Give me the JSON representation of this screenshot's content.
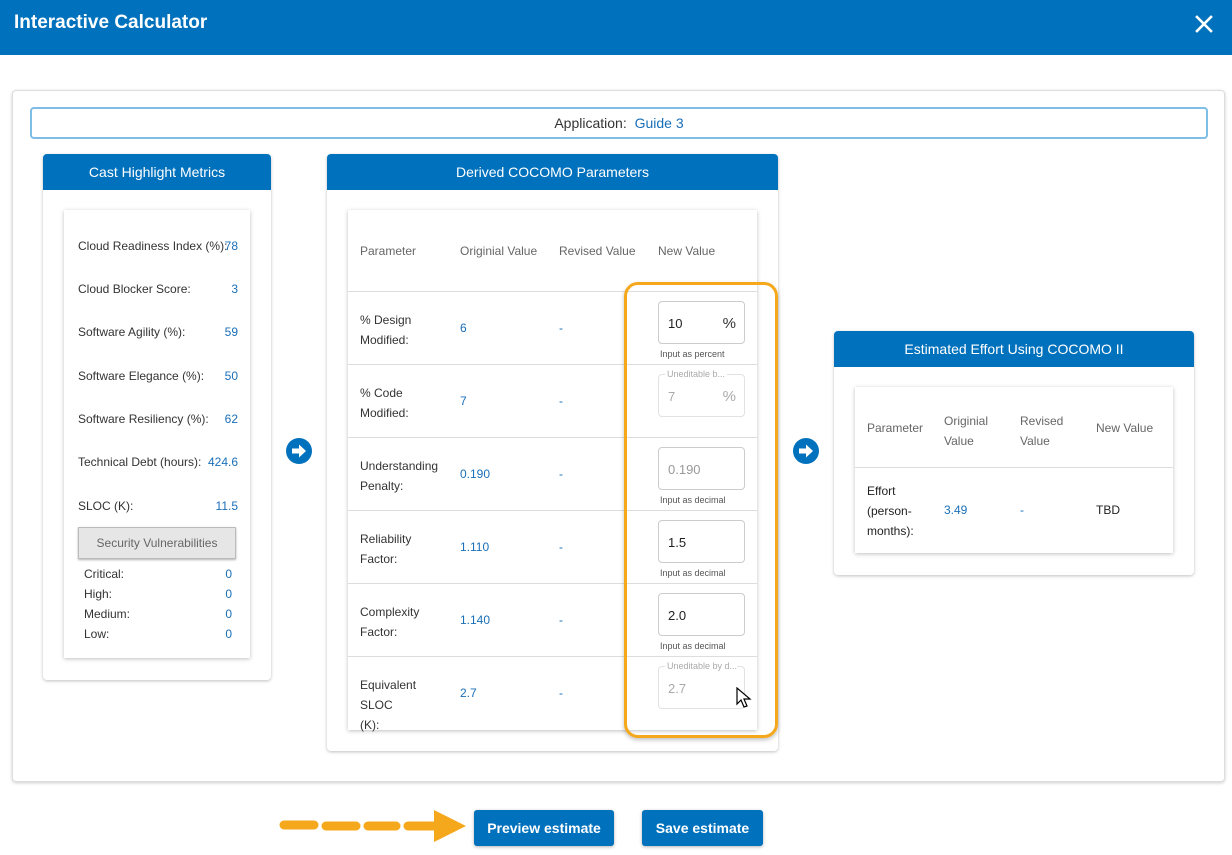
{
  "window": {
    "title": "Interactive Calculator",
    "close_icon": "close-icon"
  },
  "application": {
    "label": "Application:",
    "value": "Guide 3"
  },
  "metrics_panel": {
    "title": "Cast Highlight Metrics",
    "items": [
      {
        "label": "Cloud Readiness Index (%):",
        "value": "78"
      },
      {
        "label": "Cloud Blocker Score:",
        "value": "3"
      },
      {
        "label": "Software Agility (%):",
        "value": "59"
      },
      {
        "label": "Software Elegance (%):",
        "value": "50"
      },
      {
        "label": "Software Resiliency (%):",
        "value": "62"
      },
      {
        "label": "Technical Debt (hours):",
        "value": "424.6"
      },
      {
        "label": "SLOC (K):",
        "value": "11.5"
      }
    ],
    "security_button": "Security Vulnerabilities",
    "vulnerabilities": [
      {
        "label": "Critical:",
        "value": "0"
      },
      {
        "label": "High:",
        "value": "0"
      },
      {
        "label": "Medium:",
        "value": "0"
      },
      {
        "label": "Low:",
        "value": "0"
      }
    ]
  },
  "cocomo_panel": {
    "title": "Derived COCOMO Parameters",
    "headers": [
      "Parameter",
      "Originial Value",
      "Revised Value",
      "New Value"
    ],
    "rows": [
      {
        "parameter_line1": "% Design",
        "parameter_line2": "Modified:",
        "original": "6",
        "revised": "-",
        "new_value": "10",
        "suffix": "%",
        "floating_label": "",
        "hint": "Input as percent"
      },
      {
        "parameter_line1": "% Code",
        "parameter_line2": "Modified:",
        "original": "7",
        "revised": "-",
        "new_value": "7",
        "suffix": "%",
        "floating_label": "Uneditable b...",
        "hint": ""
      },
      {
        "parameter_line1": "Understanding",
        "parameter_line2": "Penalty:",
        "original": "0.190",
        "revised": "-",
        "new_value": "0.190",
        "suffix": "",
        "floating_label": "",
        "hint": "Input as decimal"
      },
      {
        "parameter_line1": "Reliability",
        "parameter_line2": "Factor:",
        "original": "1.110",
        "revised": "-",
        "new_value": "1.5",
        "suffix": "",
        "floating_label": "",
        "hint": "Input as decimal"
      },
      {
        "parameter_line1": "Complexity",
        "parameter_line2": "Factor:",
        "original": "1.140",
        "revised": "-",
        "new_value": "2.0",
        "suffix": "",
        "floating_label": "",
        "hint": "Input as decimal"
      },
      {
        "parameter_line1": "Equivalent SLOC",
        "parameter_line2": "(K):",
        "original": "2.7",
        "revised": "-",
        "new_value": "2.7",
        "suffix": "",
        "floating_label": "Uneditable by d...",
        "hint": ""
      }
    ]
  },
  "effort_panel": {
    "title": "Estimated Effort Using COCOMO II",
    "headers": {
      "parameter": "Parameter",
      "original_l1": "Originial",
      "original_l2": "Value",
      "revised_l1": "Revised",
      "revised_l2": "Value",
      "new_value": "New Value"
    },
    "row": {
      "label_l1": "Effort",
      "label_l2": "(person-",
      "label_l3": "months):",
      "original": "3.49",
      "revised": "-",
      "new_value": "TBD"
    }
  },
  "actions": {
    "preview": "Preview estimate",
    "save": "Save estimate"
  },
  "colors": {
    "brand": "#0071bc",
    "highlight": "#f5a81c",
    "value_text": "#1a6fb8"
  }
}
